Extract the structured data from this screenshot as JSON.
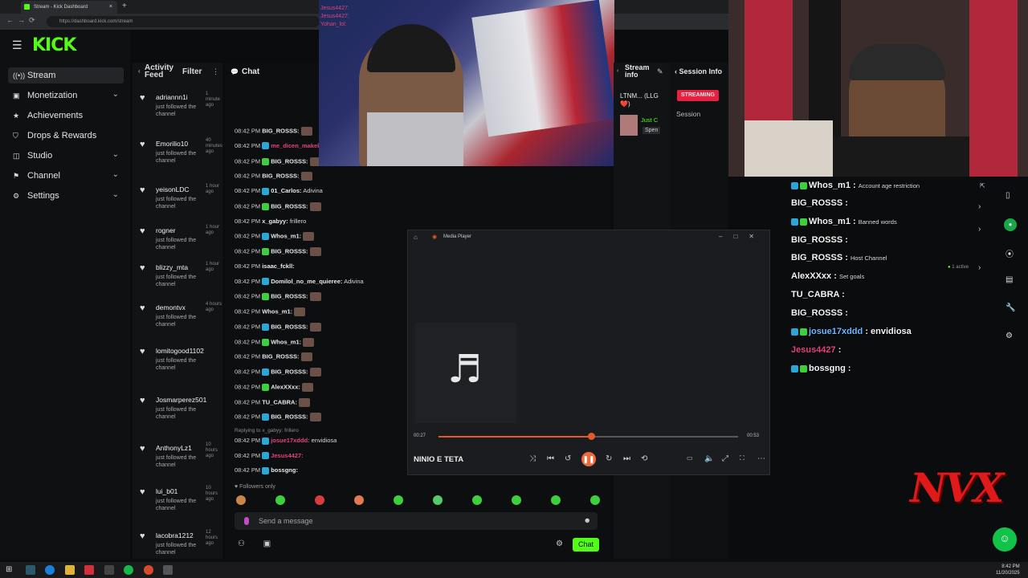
{
  "browser": {
    "tab_title": "Stream - Kick Dashboard",
    "tab_close": "×",
    "new_tab": "+",
    "url": "https://dashboard.kick.com/stream",
    "nav": [
      "←",
      "→",
      "⟳"
    ]
  },
  "brand": {
    "logo": "KICK",
    "accent": "#53fc18"
  },
  "sidebar": {
    "items": [
      {
        "label": "Stream",
        "icon": "stream-icon",
        "glyph": "((•))",
        "expand": false,
        "active": true
      },
      {
        "label": "Monetization",
        "icon": "monetization-icon",
        "glyph": "▣",
        "expand": true
      },
      {
        "label": "Achievements",
        "icon": "achievements-icon",
        "glyph": "★",
        "expand": false
      },
      {
        "label": "Drops & Rewards",
        "icon": "drops-icon",
        "glyph": "⛉",
        "expand": false
      },
      {
        "label": "Studio",
        "icon": "studio-icon",
        "glyph": "◫",
        "expand": true
      },
      {
        "label": "Channel",
        "icon": "channel-icon",
        "glyph": "⚑",
        "expand": true
      },
      {
        "label": "Settings",
        "icon": "settings-icon",
        "glyph": "⚙",
        "expand": true
      }
    ],
    "chevron": "⌄"
  },
  "activity_feed": {
    "title": "Activity Feed",
    "filter_label": "Filter",
    "items": [
      {
        "user": "adriannn1i",
        "time": "1 minute ago",
        "desc": "just followed the channel"
      },
      {
        "user": "Emorilio10",
        "time": "40 minutes ago",
        "desc": "just followed the channel"
      },
      {
        "user": "yeisonLDC",
        "time": "1 hour ago",
        "desc": "just followed the channel"
      },
      {
        "user": "rogner",
        "time": "1 hour ago",
        "desc": "just followed the channel"
      },
      {
        "user": "blizzy_mta",
        "time": "1 hour ago",
        "desc": "just followed the channel"
      },
      {
        "user": "demontvx",
        "time": "4 hours ago",
        "desc": "just followed the channel"
      },
      {
        "user": "lomitogood1102",
        "time": "",
        "desc": "just followed the channel"
      },
      {
        "user": "Josmarperez501",
        "time": "",
        "desc": "just followed the channel"
      },
      {
        "user": "AnthonyLz1",
        "time": "10 hours ago",
        "desc": "just followed the channel"
      },
      {
        "user": "lui_b01",
        "time": "10 hours ago",
        "desc": "just followed the channel"
      },
      {
        "user": "lacobra1212",
        "time": "12 hours ago",
        "desc": "just followed the channel"
      }
    ]
  },
  "chat": {
    "title": "Chat",
    "lines": [
      {
        "time": "08:42 PM",
        "user": "BIG_ROSSS:",
        "text": "",
        "color": "#e8e8e8",
        "emote": true
      },
      {
        "time": "08:42 PM",
        "user": "me_dicen_makeke",
        "text": "",
        "color": "#e0457b",
        "emote": false
      },
      {
        "time": "08:42 PM",
        "user": "BIG_ROSSS:",
        "text": "",
        "color": "#e8e8e8",
        "emote": true
      },
      {
        "time": "08:42 PM",
        "user": "BIG_ROSSS:",
        "text": "",
        "color": "#e8e8e8",
        "emote": true
      },
      {
        "time": "08:42 PM",
        "user": "01_Carlos:",
        "text": "Adivina",
        "color": "#e8e8e8",
        "emote": false
      },
      {
        "time": "08:42 PM",
        "user": "BIG_ROSSS:",
        "text": "",
        "color": "#e8e8e8",
        "emote": true
      },
      {
        "time": "08:42 PM",
        "user": "x_gabyy:",
        "text": "frillero",
        "color": "#e8e8e8",
        "emote": false
      },
      {
        "time": "08:42 PM",
        "user": "Whos_m1:",
        "text": "",
        "color": "#e8e8e8",
        "emote": true
      },
      {
        "time": "08:42 PM",
        "user": "BIG_ROSSS:",
        "text": "",
        "color": "#e8e8e8",
        "emote": true
      },
      {
        "time": "08:42 PM",
        "user": "isaac_fckll:",
        "text": "",
        "color": "#e8e8e8",
        "emote": false
      },
      {
        "time": "08:42 PM",
        "user": "Domilol_no_me_quieree:",
        "text": "Adivina",
        "color": "#e8e8e8",
        "emote": false
      },
      {
        "time": "08:42 PM",
        "user": "BIG_ROSSS:",
        "text": "",
        "color": "#e8e8e8",
        "emote": true
      },
      {
        "time": "08:42 PM",
        "user": "Whos_m1:",
        "text": "",
        "color": "#e8e8e8",
        "emote": true
      },
      {
        "time": "08:42 PM",
        "user": "BIG_ROSSS:",
        "text": "",
        "color": "#e8e8e8",
        "emote": true
      },
      {
        "time": "08:42 PM",
        "user": "Whos_m1:",
        "text": "",
        "color": "#e8e8e8",
        "emote": true
      },
      {
        "time": "08:42 PM",
        "user": "BIG_ROSSS:",
        "text": "",
        "color": "#e8e8e8",
        "emote": true
      },
      {
        "time": "08:42 PM",
        "user": "BIG_ROSSS:",
        "text": "",
        "color": "#e8e8e8",
        "emote": true
      },
      {
        "time": "08:42 PM",
        "user": "AlexXXxx:",
        "text": "",
        "color": "#e8e8e8",
        "emote": true
      },
      {
        "time": "08:42 PM",
        "user": "TU_CABRA:",
        "text": "",
        "color": "#e8e8e8",
        "emote": true
      },
      {
        "time": "08:42 PM",
        "user": "BIG_ROSSS:",
        "text": "",
        "color": "#e8e8e8",
        "emote": true
      }
    ],
    "reply_note": "Replying to x_gabyy: frillero",
    "tail_lines": [
      {
        "time": "08:42 PM",
        "user": "josue17xddd:",
        "text": "envidiosa",
        "color": "#e0457b"
      },
      {
        "time": "08:42 PM",
        "user": "Jesus4427:",
        "text": "",
        "color": "#e0457b"
      },
      {
        "time": "08:42 PM",
        "user": "bossgng:",
        "text": "",
        "color": "#e8e8e8"
      }
    ],
    "followers_only": "Followers only",
    "placeholder": "Send a message",
    "send_label": "Chat",
    "emote_colors": [
      "#c9854a",
      "#3ecf3e",
      "#d63d3d",
      "#e07a52",
      "#3ecf3e",
      "#56c96a",
      "#3ecf3e",
      "#3ecf3e",
      "#3ecf3e",
      "#3ecf3e"
    ]
  },
  "cam_chat": [
    {
      "user": "Jesus4427:",
      "color": "#e0457b"
    },
    {
      "user": "Jesus4427:",
      "color": "#e0457b"
    },
    {
      "user": "Yohan_lol:",
      "color": "#e0457b"
    }
  ],
  "stream_info": {
    "title": "Stream info",
    "stream_title": "LTNM... (LLG❤️)",
    "category_short": "Just C",
    "tag_short": "Spen"
  },
  "session_info": {
    "title": "Session Info",
    "live_badge": "STREAMING",
    "session_label": "Session",
    "live_color": "#e6213f"
  },
  "media_player": {
    "app_title": "Media Player",
    "song": "NINIO E TETA",
    "current": "00:27",
    "duration": "00:53",
    "progress": 0.51,
    "accent": "#e45b2a"
  },
  "overlay_chat": {
    "lines": [
      {
        "user": "Whos_m1 :",
        "badges": true,
        "note": "Account age restriction"
      },
      {
        "user": "BIG_ROSSS :",
        "badges": false,
        "note": ""
      },
      {
        "user": "Whos_m1 :",
        "badges": true,
        "note": "Banned words"
      },
      {
        "user": "BIG_ROSSS :",
        "badges": false,
        "note": ""
      },
      {
        "user": "BIG_ROSSS :",
        "badges": false,
        "note": "Host Channel"
      },
      {
        "user": "AlexXXxx :",
        "badges": false,
        "note": "Set goals"
      },
      {
        "user": "TU_CABRA :",
        "badges": false,
        "note": ""
      },
      {
        "user": "BIG_ROSSS :",
        "badges": false,
        "note": ""
      },
      {
        "user": "josue17xddd",
        "badges": true,
        "note": ": envidiosa",
        "color": "#6fb6ff"
      },
      {
        "user": "Jesus4427",
        "badges": false,
        "note": ":",
        "color": "#e0457b"
      },
      {
        "user": "bossgng :",
        "badges": true,
        "note": ""
      }
    ],
    "active_count": "1 active"
  },
  "overlay_logo": "NVX",
  "clock": {
    "time": "8:42 PM",
    "date": "11/20/2025"
  }
}
